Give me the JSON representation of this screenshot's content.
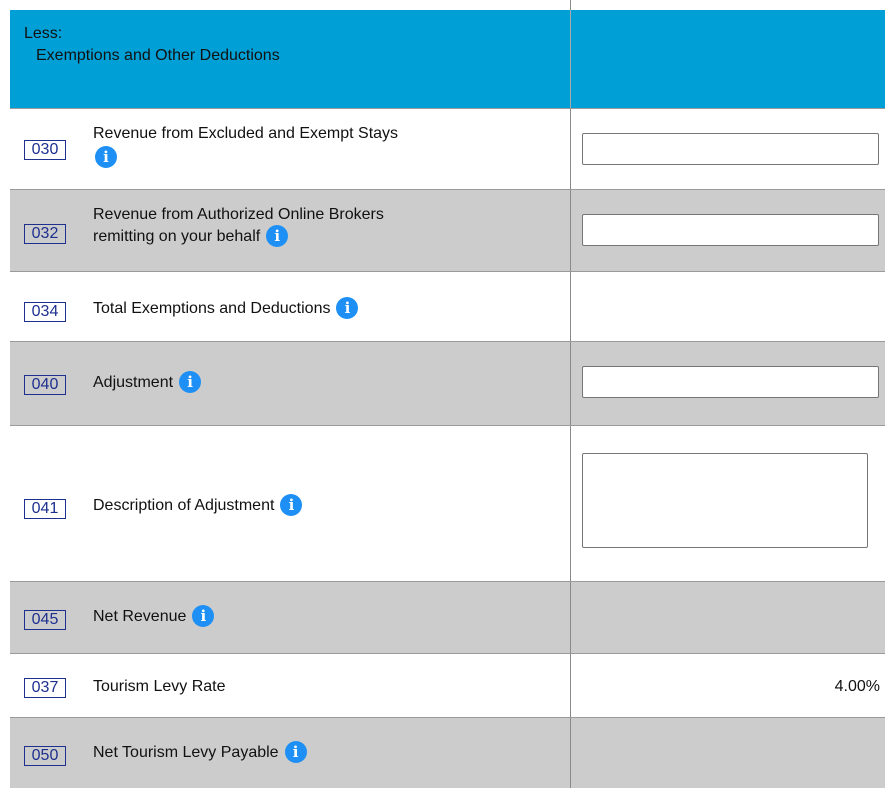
{
  "header": {
    "line1": "Less:",
    "line2": "Exemptions and Other Deductions"
  },
  "rows": [
    {
      "code": "030",
      "label_line1": "Revenue from Excluded and Exempt Stays",
      "has_input": true
    },
    {
      "code": "032",
      "label_line1": "Revenue from Authorized Online Brokers",
      "label_line2": "remitting on your behalf",
      "has_input": true
    },
    {
      "code": "034",
      "label": "Total Exemptions and Deductions",
      "has_input": false
    },
    {
      "code": "040",
      "label": "Adjustment",
      "has_input": true
    },
    {
      "code": "041",
      "label": "Description of Adjustment",
      "has_textarea": true
    },
    {
      "code": "045",
      "label": "Net Revenue",
      "has_input": false
    },
    {
      "code": "037",
      "label": "Tourism Levy Rate",
      "value": "4.00%"
    },
    {
      "code": "050",
      "label": "Net Tourism Levy Payable",
      "has_input": false
    }
  ],
  "colors": {
    "header_bg": "#00a0d6",
    "row_gray": "#cccccc",
    "code_border": "#1d2f8f",
    "info_icon": "#1e90f5"
  }
}
